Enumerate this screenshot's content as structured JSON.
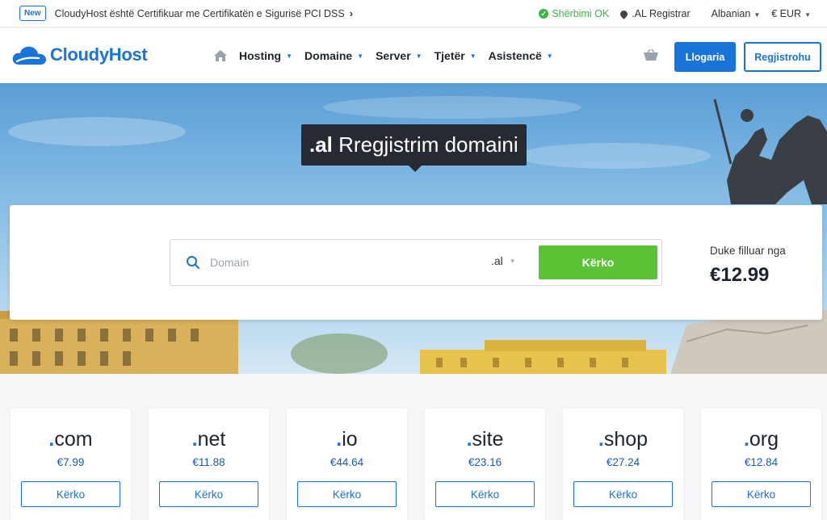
{
  "topbar": {
    "badge": "New",
    "announcement": "CloudyHost është Certifikuar me Certifikatën e Sigurisë PCI DSS",
    "status": "Shërbimi OK",
    "registrar": ".AL Registrar",
    "language": "Albanian",
    "currency": "€ EUR"
  },
  "header": {
    "logo": "CloudyHost",
    "nav": [
      "Hosting",
      "Domaine",
      "Server",
      "Tjetër",
      "Asistencë"
    ],
    "login": "Llogaria",
    "register": "Regjistrohu"
  },
  "hero": {
    "title_tld": ".al",
    "title_text": " Rregjistrim domaini",
    "search_placeholder": "Domain",
    "selected_tld": ".al",
    "search_button": "Kërko",
    "price_label": "Duke filluar nga",
    "price": "€12.99"
  },
  "tlds": [
    {
      "tld": "com",
      "price": "€7.99",
      "button": "Kërko"
    },
    {
      "tld": "net",
      "price": "€11.88",
      "button": "Kërko"
    },
    {
      "tld": "io",
      "price": "€44.64",
      "button": "Kërko"
    },
    {
      "tld": "site",
      "price": "€23.16",
      "button": "Kërko"
    },
    {
      "tld": "shop",
      "price": "€27.24",
      "button": "Kërko"
    },
    {
      "tld": "org",
      "price": "€12.84",
      "button": "Kërko"
    }
  ],
  "colors": {
    "brand": "#1a73d9",
    "success": "#5bc236",
    "status_ok": "#3db34a",
    "title_bg": "#262a33"
  }
}
